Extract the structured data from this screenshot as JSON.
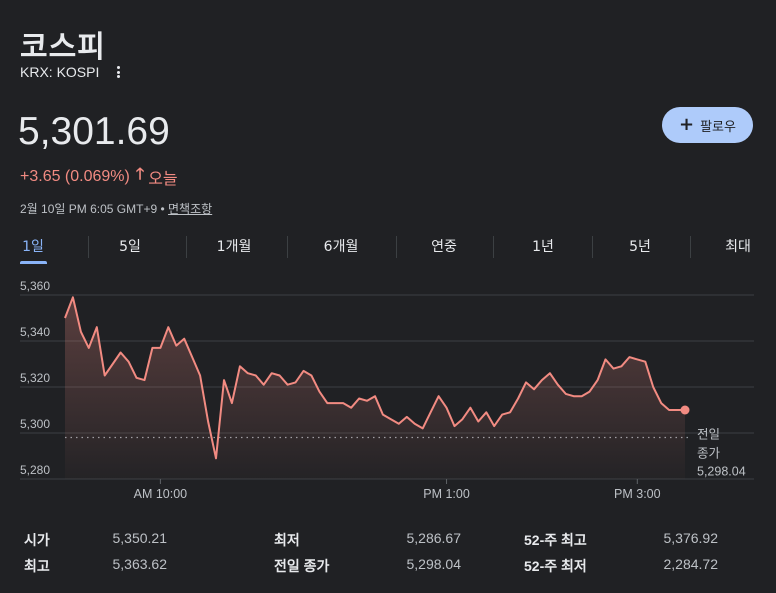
{
  "header": {
    "title": "코스피",
    "ticker": "KRX: KOSPI"
  },
  "quote": {
    "price": "5,301.69",
    "change": "+3.65 (0.069%)",
    "change_arrow": "🡑",
    "change_period": "오늘",
    "timestamp": "2월 10일 PM 6:05 GMT+9 • ",
    "disclaimer": "면책조항"
  },
  "follow_button": {
    "label": "팔로우"
  },
  "tabs": [
    {
      "label": "1일",
      "active": true
    },
    {
      "label": "5일"
    },
    {
      "label": "1개월"
    },
    {
      "label": "6개월"
    },
    {
      "label": "연중"
    },
    {
      "label": "1년"
    },
    {
      "label": "5년"
    },
    {
      "label": "최대"
    }
  ],
  "chart_data": {
    "type": "area",
    "y_ticks": [
      "5,360",
      "5,340",
      "5,320",
      "5,300",
      "5,280"
    ],
    "ylim": [
      5280,
      5360
    ],
    "x_ticks": [
      {
        "label": "AM 10:00",
        "t": 60
      },
      {
        "label": "PM 1:00",
        "t": 240
      },
      {
        "label": "PM 3:00",
        "t": 360
      }
    ],
    "xlim": [
      0,
      390
    ],
    "grid": true,
    "line_color": "#f28b82",
    "previous_close": {
      "value": 5298.04,
      "label_line1": "전일",
      "label_line2": "종가",
      "label_value": "5,298.04"
    },
    "series": [
      {
        "values": [
          [
            0,
            5350
          ],
          [
            5,
            5359
          ],
          [
            10,
            5344
          ],
          [
            15,
            5337
          ],
          [
            20,
            5346
          ],
          [
            25,
            5325
          ],
          [
            30,
            5330
          ],
          [
            35,
            5335
          ],
          [
            40,
            5331
          ],
          [
            45,
            5324
          ],
          [
            50,
            5323
          ],
          [
            55,
            5337
          ],
          [
            60,
            5337
          ],
          [
            65,
            5346
          ],
          [
            70,
            5338
          ],
          [
            75,
            5341
          ],
          [
            80,
            5333
          ],
          [
            85,
            5325
          ],
          [
            90,
            5305
          ],
          [
            95,
            5289
          ],
          [
            100,
            5323
          ],
          [
            105,
            5313
          ],
          [
            110,
            5329
          ],
          [
            115,
            5326
          ],
          [
            120,
            5325
          ],
          [
            125,
            5321
          ],
          [
            130,
            5326
          ],
          [
            135,
            5325
          ],
          [
            140,
            5321
          ],
          [
            145,
            5322
          ],
          [
            150,
            5327
          ],
          [
            155,
            5325
          ],
          [
            160,
            5318
          ],
          [
            165,
            5313
          ],
          [
            170,
            5313
          ],
          [
            175,
            5313
          ],
          [
            180,
            5311
          ],
          [
            185,
            5315
          ],
          [
            190,
            5314
          ],
          [
            195,
            5316
          ],
          [
            200,
            5308
          ],
          [
            205,
            5306
          ],
          [
            210,
            5304
          ],
          [
            215,
            5307
          ],
          [
            220,
            5304
          ],
          [
            225,
            5302
          ],
          [
            230,
            5309
          ],
          [
            235,
            5316
          ],
          [
            240,
            5311
          ],
          [
            245,
            5303
          ],
          [
            250,
            5306
          ],
          [
            255,
            5311
          ],
          [
            260,
            5305
          ],
          [
            265,
            5309
          ],
          [
            270,
            5303
          ],
          [
            275,
            5308
          ],
          [
            280,
            5309
          ],
          [
            285,
            5315
          ],
          [
            290,
            5322
          ],
          [
            295,
            5319
          ],
          [
            300,
            5323
          ],
          [
            305,
            5326
          ],
          [
            310,
            5321
          ],
          [
            315,
            5317
          ],
          [
            320,
            5316
          ],
          [
            325,
            5316
          ],
          [
            330,
            5318
          ],
          [
            335,
            5323
          ],
          [
            340,
            5332
          ],
          [
            345,
            5328
          ],
          [
            350,
            5329
          ],
          [
            355,
            5333
          ],
          [
            360,
            5332
          ],
          [
            365,
            5331
          ],
          [
            370,
            5320
          ],
          [
            375,
            5313
          ],
          [
            380,
            5310
          ],
          [
            385,
            5310
          ],
          [
            390,
            5310
          ]
        ]
      }
    ]
  },
  "stats": [
    {
      "label": "시가",
      "value": "5,350.21"
    },
    {
      "label": "최고",
      "value": "5,363.62"
    },
    {
      "label": "최저",
      "value": "5,286.67"
    },
    {
      "label": "전일 종가",
      "value": "5,298.04"
    },
    {
      "label": "52-주 최고",
      "value": "5,376.92"
    },
    {
      "label": "52-주 최저",
      "value": "2,284.72"
    }
  ]
}
